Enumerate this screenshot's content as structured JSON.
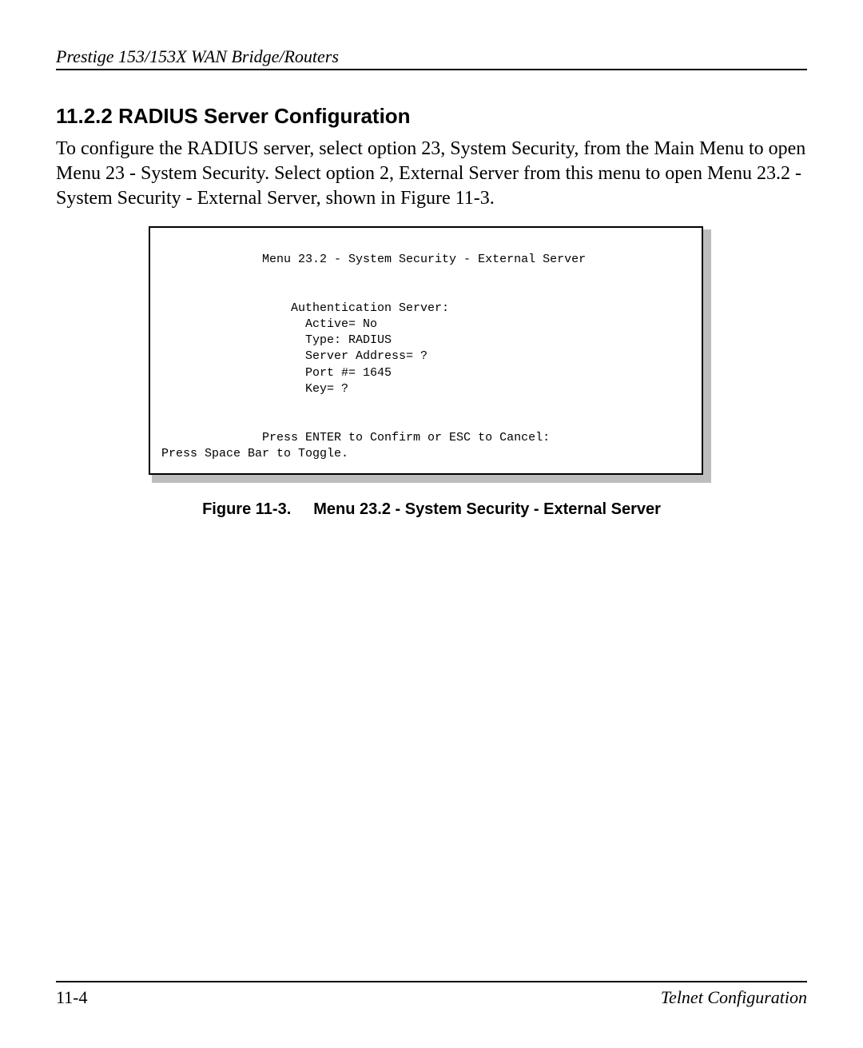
{
  "header": {
    "running_title": "Prestige 153/153X  WAN Bridge/Routers"
  },
  "section": {
    "heading": "11.2.2 RADIUS Server Configuration",
    "paragraph": "To configure the RADIUS server, select option 23, System Security, from the Main Menu to open Menu 23 - System Security.  Select option 2, External Server from this menu to open Menu 23.2 - System Security - External Server, shown in Figure 11-3."
  },
  "menu": {
    "title": "              Menu 23.2 - System Security - External Server",
    "blank1": "",
    "blank2": "",
    "auth_header": "                  Authentication Server:",
    "active": "                    Active= No",
    "type": "                    Type: RADIUS",
    "server_address": "                    Server Address= ?",
    "port": "                    Port #= 1645",
    "key": "                    Key= ?",
    "blank3": "",
    "blank4": "",
    "confirm": "              Press ENTER to Confirm or ESC to Cancel:",
    "toggle": "Press Space Bar to Toggle."
  },
  "figure": {
    "number": "Figure 11-3.",
    "caption": "Menu 23.2 - System Security - External Server"
  },
  "footer": {
    "page_number": "11-4",
    "chapter": "Telnet Configuration"
  }
}
